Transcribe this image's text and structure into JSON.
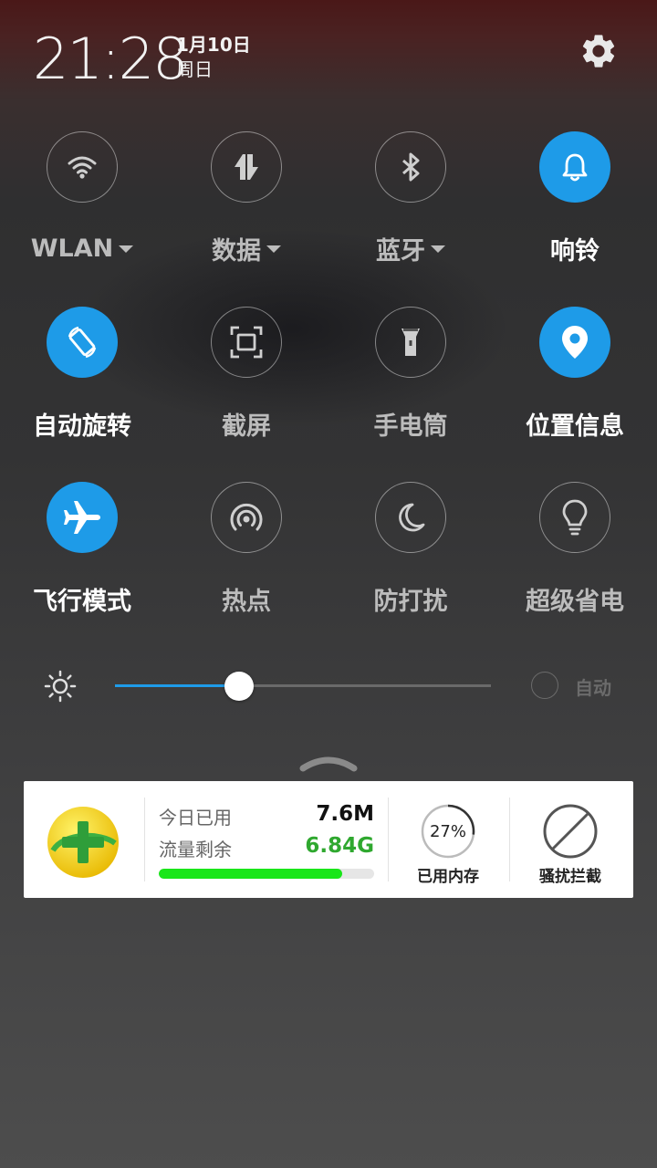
{
  "status": {
    "time": "21:28",
    "date": "1月10日",
    "weekday": "周日"
  },
  "colors": {
    "accent": "#1e9be8",
    "data_remaining": "#2fa82f",
    "usage_bar": "#19e619"
  },
  "tiles": [
    {
      "label": "WLAN",
      "icon": "wifi-icon",
      "active": false,
      "dropdown": true
    },
    {
      "label": "数据",
      "icon": "data-arrows-icon",
      "active": false,
      "dropdown": true
    },
    {
      "label": "蓝牙",
      "icon": "bluetooth-icon",
      "active": false,
      "dropdown": true
    },
    {
      "label": "响铃",
      "icon": "bell-icon",
      "active": true,
      "dropdown": false
    },
    {
      "label": "自动旋转",
      "icon": "rotate-icon",
      "active": true,
      "dropdown": false
    },
    {
      "label": "截屏",
      "icon": "screenshot-icon",
      "active": false,
      "dropdown": false
    },
    {
      "label": "手电筒",
      "icon": "flashlight-icon",
      "active": false,
      "dropdown": false
    },
    {
      "label": "位置信息",
      "icon": "location-pin-icon",
      "active": true,
      "dropdown": false
    },
    {
      "label": "飞行模式",
      "icon": "airplane-icon",
      "active": true,
      "dropdown": false
    },
    {
      "label": "热点",
      "icon": "hotspot-icon",
      "active": false,
      "dropdown": false
    },
    {
      "label": "防打扰",
      "icon": "moon-icon",
      "active": false,
      "dropdown": false
    },
    {
      "label": "超级省电",
      "icon": "lightbulb-icon",
      "active": false,
      "dropdown": false
    }
  ],
  "brightness": {
    "level": 0.33,
    "auto_label": "自动",
    "auto_enabled": false
  },
  "widget": {
    "today_used_label": "今日已用",
    "today_used_value": "7.6M",
    "remaining_label": "流量剩余",
    "remaining_value": "6.84G",
    "usage_fraction": 0.85,
    "memory_percent": "27%",
    "memory_fraction": 0.27,
    "memory_label": "已用内存",
    "block_label": "骚扰拦截"
  }
}
